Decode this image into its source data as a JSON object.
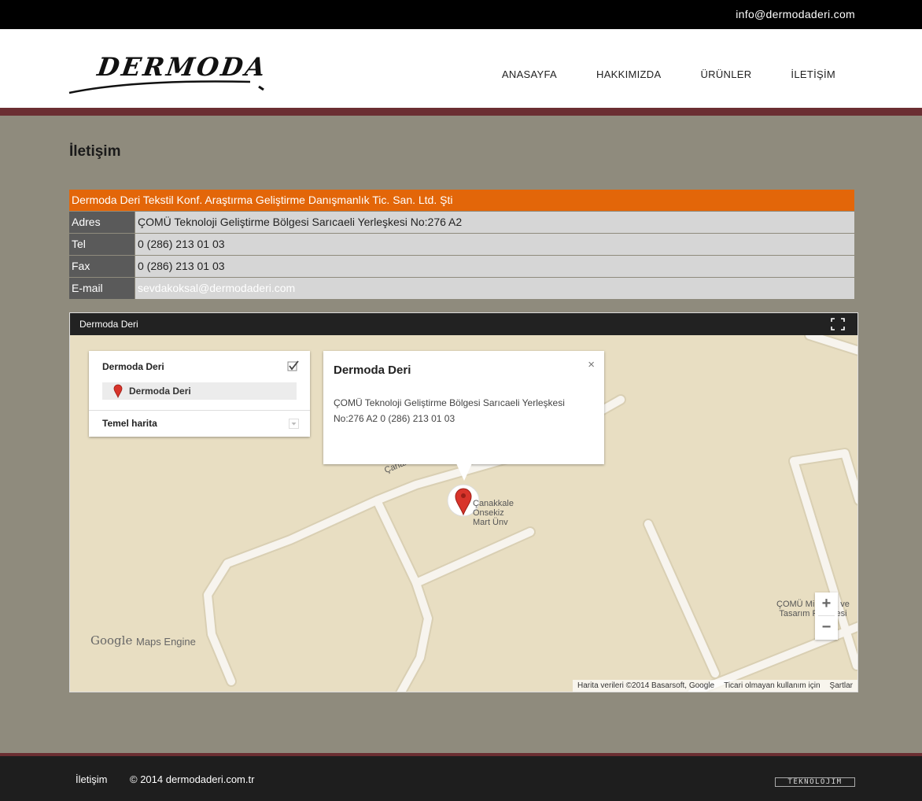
{
  "topbar": {
    "email": "info@dermodaderi.com"
  },
  "header": {
    "logo_text": "DERMODA",
    "nav": [
      "ANASAYFA",
      "HAKKIMIZDA",
      "ÜRÜNLER",
      "İLETİŞİM"
    ]
  },
  "page": {
    "title": "İletişim"
  },
  "contact": {
    "company": "Dermoda Deri Tekstil Konf. Araştırma Geliştirme Danışmanlık Tic. San. Ltd. Şti",
    "rows": [
      {
        "label": "Adres",
        "value": "ÇOMÜ Teknoloji Geliştirme Bölgesi Sarıcaeli Yerleşkesi  No:276 A2"
      },
      {
        "label": "Tel",
        "value": "0 (286) 213 01 03"
      },
      {
        "label": "Fax",
        "value": "0 (286) 213 01 03"
      },
      {
        "label": "E-mail",
        "value": "sevdakoksal@dermodaderi.com"
      }
    ]
  },
  "map": {
    "title": "Dermoda Deri",
    "icons": {
      "fullscreen": "fullscreen-icon",
      "check": "check-icon",
      "pin": "map-pin-icon",
      "dropdown": "dropdown-icon"
    },
    "layer_panel": {
      "title": "Dermoda Deri",
      "item": "Dermoda Deri",
      "basemap": "Temel harita"
    },
    "infowindow": {
      "title": "Dermoda Deri",
      "close": "×",
      "body": "ÇOMÜ Teknoloji Geliştirme Bölgesi Sarıcaeli Yerleşkesi  No:276 A2 0 (286) 213 01 03"
    },
    "pois": {
      "university": [
        "Çanakkale",
        "Onsekiz",
        "Mart Ünv"
      ],
      "faculty": [
        "ÇOMÜ Mimarlık ve",
        "Tasarım Fakültesi"
      ],
      "road": "Çanakkale"
    },
    "zoom_in": "+",
    "zoom_out": "−",
    "google": "Google",
    "maps_engine": "Maps Engine",
    "attribution": [
      "Harita verileri ©2014 Basarsoft, Google",
      "Ticari olmayan kullanım için",
      "Şartlar"
    ],
    "colors": {
      "land": "#e8dec2",
      "road": "#f7f4ee",
      "pin": "#d8342b"
    }
  },
  "footer": {
    "link": "İletişim",
    "copyright": "© 2014 dermodaderi.com.tr",
    "badge": "TEKNOLOJIM"
  },
  "colors": {
    "accent": "#e36609",
    "stripe": "#6b2e32",
    "background": "#8f8b7d"
  }
}
